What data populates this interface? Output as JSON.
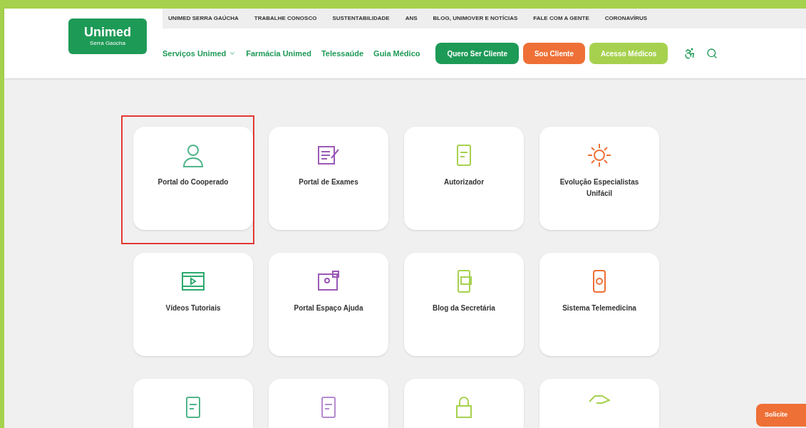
{
  "logo": {
    "name": "Unimed",
    "tagline": "Serra Gaúcha"
  },
  "top_links": [
    "UNIMED SERRA GAÚCHA",
    "TRABALHE CONOSCO",
    "SUSTENTABILIDADE",
    "ANS",
    "BLOG, UNIMOVER E NOTÍCIAS",
    "FALE COM A GENTE",
    "CORONAVÍRUS"
  ],
  "main_nav": [
    {
      "label": "Serviços Unimed",
      "dropdown": true
    },
    {
      "label": "Farmácia Unimed",
      "dropdown": false
    },
    {
      "label": "Telessaúde",
      "dropdown": false
    },
    {
      "label": "Guia Médico",
      "dropdown": false
    }
  ],
  "cta_buttons": [
    {
      "label": "Quero Ser Cliente",
      "color": "#1e9a57"
    },
    {
      "label": "Sou Cliente",
      "color": "#ee7036"
    },
    {
      "label": "Acesso Médicos",
      "color": "#a6d14e"
    }
  ],
  "cards": [
    {
      "label": "Portal do Cooperado",
      "kind": "person",
      "color": "#4fb58a",
      "highlighted": true
    },
    {
      "label": "Portal de Exames",
      "kind": "form",
      "color": "#9b59b6",
      "highlighted": false
    },
    {
      "label": "Autorizador",
      "kind": "doc",
      "color": "#a6d14e",
      "highlighted": false
    },
    {
      "label": "Evolução Especialistas Unifácil",
      "kind": "sun",
      "color": "#ee7036",
      "highlighted": false
    },
    {
      "label": "Vídeos Tutoriais",
      "kind": "film",
      "color": "#2eaa6e",
      "highlighted": false
    },
    {
      "label": "Portal Espaço Ajuda",
      "kind": "screen",
      "color": "#9b59b6",
      "highlighted": false
    },
    {
      "label": "Blog da Secretária",
      "kind": "phone",
      "color": "#a6d14e",
      "highlighted": false
    },
    {
      "label": "Sistema Telemedicina",
      "kind": "mobile",
      "color": "#ee7036",
      "highlighted": false
    },
    {
      "kind": "doc",
      "color": "#4fb58a",
      "highlighted": false
    },
    {
      "kind": "doc",
      "color": "#b48ad0",
      "highlighted": false
    },
    {
      "kind": "lock",
      "color": "#a6d14e",
      "highlighted": false
    },
    {
      "kind": "hand",
      "color": "#a6d14e",
      "highlighted": false
    }
  ],
  "floating_button": {
    "label": "Solicite"
  }
}
